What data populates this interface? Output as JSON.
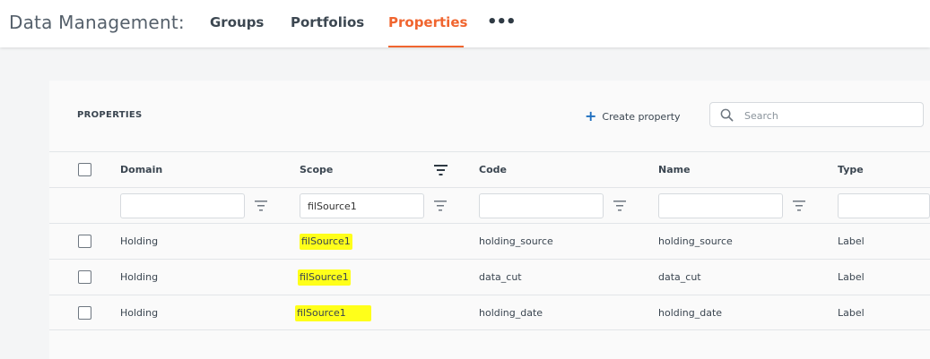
{
  "nav": {
    "title": "Data Management:",
    "tabs": [
      {
        "label": "Groups"
      },
      {
        "label": "Portfolios"
      },
      {
        "label": "Properties"
      }
    ],
    "more": "•••"
  },
  "panel": {
    "title": "PROPERTIES",
    "create_label": "Create property",
    "search_placeholder": "Search"
  },
  "table": {
    "columns": [
      "Domain",
      "Scope",
      "Code",
      "Name",
      "Type"
    ],
    "filters": [
      "",
      "filSource1",
      "",
      "",
      ""
    ],
    "rows": [
      {
        "domain": "Holding",
        "scope": "filSource1",
        "code": "holding_source",
        "name": "holding_source",
        "type": "Label"
      },
      {
        "domain": "Holding",
        "scope": "filSource1",
        "code": "data_cut",
        "name": "data_cut",
        "type": "Label"
      },
      {
        "domain": "Holding",
        "scope": "filSource1",
        "code": "holding_date",
        "name": "holding_date",
        "type": "Label"
      }
    ]
  },
  "colors": {
    "accent": "#f0652f",
    "highlight": "#ffff1a",
    "link_blue": "#1f6fbf"
  }
}
